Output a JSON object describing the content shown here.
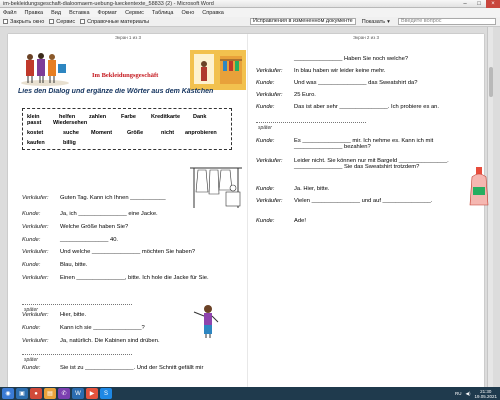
{
  "window": {
    "title": "im-bekleidungsgeschaft-dialoomaem-uebung-lueckentexte_58833 (2) - Microsoft Word"
  },
  "menu": [
    "Файл",
    "Правка",
    "Вид",
    "Вставка",
    "Формат",
    "Сервис",
    "Таблица",
    "Окно",
    "Справка"
  ],
  "toolbar": {
    "read_mode": "Закрыть окно",
    "tools": "Сервис",
    "docs": "Справочные материалы",
    "zoom": "Исправления в измененном документе",
    "show": "Показать",
    "search_placeholder": "Введите вопрос"
  },
  "left_page": {
    "page_label": "Экран 1 из 3",
    "title": "Im Bekleidungsgeschäft",
    "subtitle": "Lies den Dialog und ergänze die Wörter aus dem Kästchen",
    "words": [
      "klein",
      "helfen",
      "zahlen",
      "Farbe",
      "Kreditkarte",
      "Dank",
      "passt",
      "Wiedersehen",
      "kostet",
      "suche",
      "Moment",
      "Größe",
      "nicht",
      "anprobieren",
      "kaufen",
      "billig"
    ],
    "dialog": [
      {
        "speaker": "Verkäufer:",
        "text": "Guten Tag. Kann ich Ihnen ___________"
      },
      {
        "speaker": "Kunde:",
        "text": "Ja, ich _______________ eine Jacke."
      },
      {
        "speaker": "Verkäufer:",
        "text": "Welche Größe haben Sie?"
      },
      {
        "speaker": "Kunde:",
        "text": "_______________ 40."
      },
      {
        "speaker": "Verkäufer:",
        "text": "Und welche _______________ möchten Sie haben?"
      },
      {
        "speaker": "Kunde:",
        "text": "Blau, bitte."
      },
      {
        "speaker": "Verkäufer:",
        "text": "Einen _______________, bitte. Ich hole die Jacke für Sie."
      },
      {
        "speaker": "Verkäufer:",
        "text": "Hier, bitte."
      },
      {
        "speaker": "Kunde:",
        "text": "Kann ich sie _______________?"
      },
      {
        "speaker": "Verkäufer:",
        "text": "Ja, natürlich. Die Kabinen sind drüben."
      },
      {
        "speaker": "Kunde:",
        "text": "Sie ist zu _______________. Und der Schnitt gefällt mir"
      }
    ],
    "later1": "später",
    "later2": "später"
  },
  "right_page": {
    "page_label": "Экран 2 из 3",
    "top_text": "_______________ Haben Sie noch welche?",
    "dialog": [
      {
        "speaker": "Verkäufer:",
        "text": "In blau haben wir leider keine mehr."
      },
      {
        "speaker": "Kunde:",
        "text": "Und was _______________ das Sweatshirt da?"
      },
      {
        "speaker": "Verkäufer:",
        "text": "25 Euro."
      },
      {
        "speaker": "Kunde:",
        "text": "Das ist aber sehr _______________. Ich probiere es an."
      },
      {
        "speaker": "Kunde:",
        "text": "Es _______________ mir. Ich nehme es. Kann ich mit _______________ bezahlen?"
      },
      {
        "speaker": "Verkäufer:",
        "text": "Leider nicht. Sie können nur mit Bargeld _______________. _______________ Sie das Sweatshirt trotzdem?"
      },
      {
        "speaker": "Kunde:",
        "text": "Ja. Hier, bitte."
      },
      {
        "speaker": "Verkäufer:",
        "text": "Vielen _______________ und auf _______________."
      },
      {
        "speaker": "Kunde:",
        "text": "Ade!"
      }
    ],
    "later": "später"
  },
  "side": {
    "help_hint": "Введите вопрос"
  },
  "taskbar": {
    "lang": "RU",
    "time": "21:30",
    "date": "19.05.2021"
  }
}
